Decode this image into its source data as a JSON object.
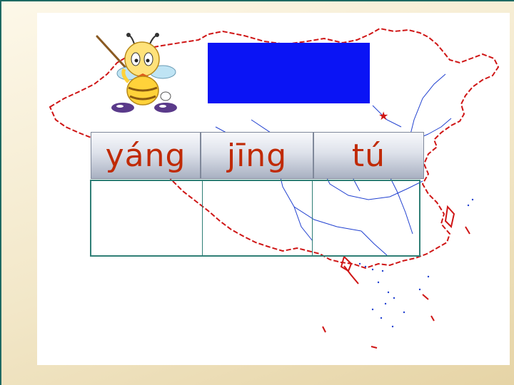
{
  "title_box": {
    "color": "#0a14f5",
    "text": ""
  },
  "pinyin": [
    "yáng",
    "jīng",
    "tú"
  ],
  "hanzi": [
    "",
    "",
    ""
  ],
  "phrases": [
    [
      "",
      "",
      ""
    ],
    [
      "",
      "",
      ""
    ]
  ],
  "colors": {
    "pinyin_text": "#c02a05",
    "phrase_text": "#1f7d72",
    "map_border": "#cf1515",
    "map_province": "#2040d0",
    "table_border": "#2f7f76"
  },
  "icons": {
    "mascot": "bee-teacher-with-pointer",
    "map": "china-outline-map",
    "capital_star": "star"
  }
}
